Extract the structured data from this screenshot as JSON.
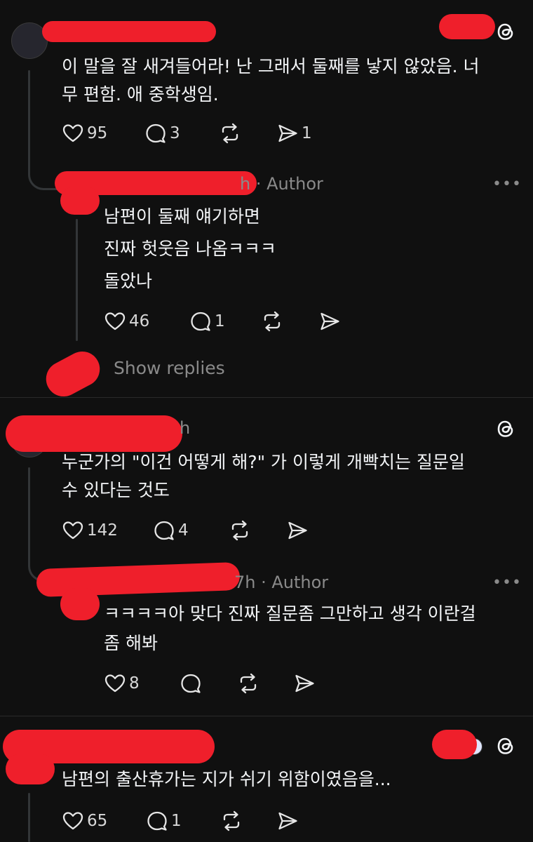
{
  "colors": {
    "background": "#101010",
    "text": "#f3f5f7",
    "muted": "#8a8a8a",
    "redaction": "#ef1f2b"
  },
  "icons": [
    "heart-icon",
    "comment-icon",
    "repost-icon",
    "share-icon",
    "threads-logo-icon",
    "more-icon"
  ],
  "post1": {
    "line1": "이 말을 잘 새겨들어라! 난 그래서 둘째를 낳지 않았음. 너",
    "line2": "무 편함. 애 중학생임.",
    "likes": "95",
    "comments": "3",
    "shares": "1"
  },
  "reply1": {
    "meta": "h · Author",
    "line1": "남편이 둘째 얘기하면",
    "line2": "진짜 헛웃음 나옴ㅋㅋㅋ",
    "line3": "돌았나",
    "likes": "46",
    "comments": "1"
  },
  "show_replies": "Show replies",
  "post2": {
    "time": "h",
    "line1": "누군가의 \"이건 어떻게 해?\" 가 이렇게 개빡치는 질문일",
    "line2": "수 있다는 것도",
    "likes": "142",
    "comments": "4"
  },
  "reply2": {
    "meta": "7h · Author",
    "line1": "ㅋㅋㅋㅋ아 맞다 진짜 질문좀 그만하고 생각 이란걸",
    "line2": "좀 해봐",
    "likes": "8"
  },
  "post3": {
    "line1": "남편의 출산휴가는 지가 쉬기 위함이였음을...",
    "likes": "65",
    "comments": "1"
  },
  "more_label": "•••"
}
